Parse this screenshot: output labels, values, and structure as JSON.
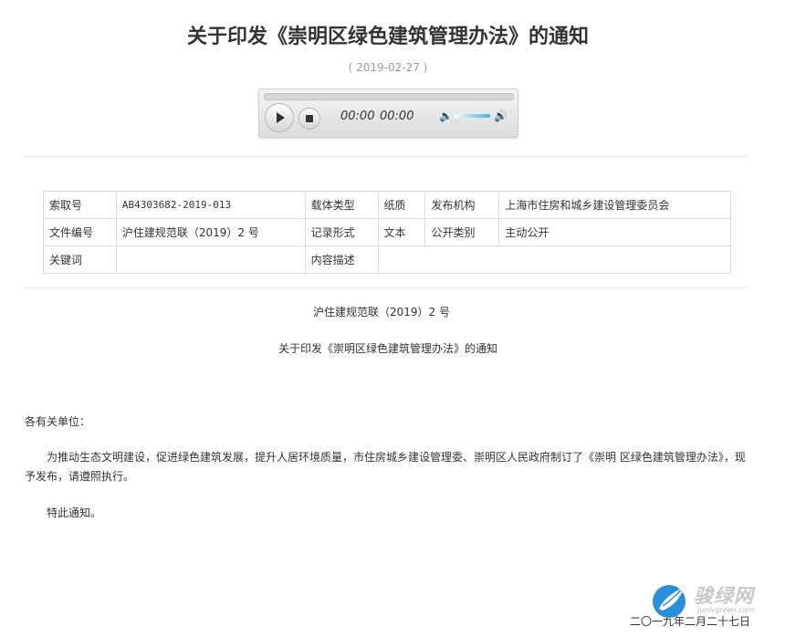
{
  "header": {
    "title": "关于印发《崇明区绿色建筑管理办法》的通知",
    "date": "( 2019-02-27 )"
  },
  "player": {
    "current_time": "00:00",
    "duration": "00:00",
    "progress": 0,
    "volume_level": 0.8,
    "icons": [
      "play-icon",
      "stop-icon",
      "mute-icon",
      "volume-max-icon"
    ]
  },
  "meta": {
    "rows": [
      [
        "索取号",
        "AB4303682-2019-013",
        "载体类型",
        "纸质",
        "发布机构",
        "上海市住房和城乡建设管理委员会"
      ],
      [
        "文件编号",
        "沪住建规范联（2019）2 号",
        "记录形式",
        "文本",
        "公开类别",
        "主动公开"
      ],
      [
        "关键词",
        "",
        "内容描述",
        ""
      ]
    ]
  },
  "body": {
    "doc_number": "沪住建规范联（2019）2 号",
    "doc_title": "关于印发《崇明区绿色建筑管理办法》的通知",
    "salutation": "各有关单位：",
    "paragraph": "为推动生态文明建设，促进绿色建筑发展，提升人居环境质量，市住房城乡建设管理委、崇明区人民政府制订了《崇明 区绿色建筑管理办法》，现予发布，请遵照执行。",
    "closing": "特此通知。",
    "sign_date": "二〇一九年二月二十七日"
  },
  "watermark": {
    "text": "骏绿网",
    "sub": "junlvgreen.com"
  }
}
